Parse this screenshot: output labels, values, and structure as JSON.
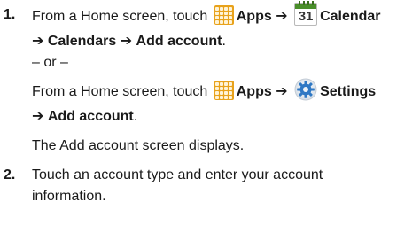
{
  "steps": [
    {
      "number": "1.",
      "line1": {
        "text_pre": "From a Home screen, touch",
        "apps_label": "Apps",
        "arrow": "➔",
        "calendar_number": "31",
        "calendar_label": "Calendar"
      },
      "line2": {
        "arrow1": "➔",
        "calendars": "Calendars",
        "arrow2": "➔",
        "add_account": "Add account",
        "period": "."
      },
      "or_text": "– or –",
      "line4": {
        "text_pre": "From a Home screen, touch",
        "apps_label": "Apps",
        "arrow": "➔",
        "settings_label": "Settings"
      },
      "line5": {
        "arrow": "➔",
        "add_account": "Add account",
        "period": "."
      },
      "result": "The Add account screen displays."
    },
    {
      "number": "2.",
      "line1": "Touch an account type and enter your account",
      "line2": "information."
    }
  ],
  "icons": [
    "apps-icon",
    "calendar-icon",
    "settings-icon"
  ]
}
